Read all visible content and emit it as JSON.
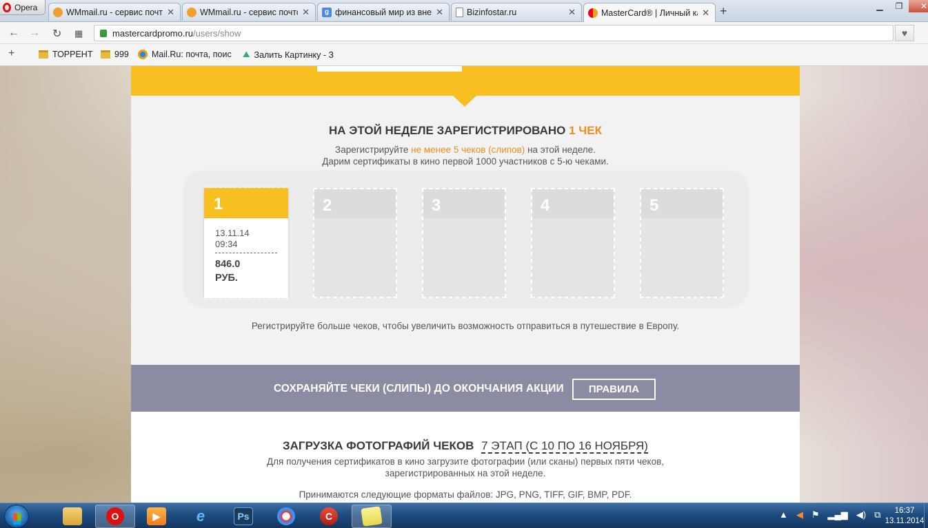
{
  "browser": {
    "app_name": "Opera",
    "tabs": [
      {
        "title": "WMmail.ru - сервис почто",
        "icon": "wmmail-icon",
        "color": "#f0a030"
      },
      {
        "title": "WMmail.ru - сервис почто",
        "icon": "wmmail-icon",
        "color": "#f0a030"
      },
      {
        "title": "финансовый мир из вне",
        "icon": "google-icon",
        "color": "#4a8be8"
      },
      {
        "title": "Bizinfostar.ru",
        "icon": "page-icon",
        "color": "#9aa"
      },
      {
        "title": "MasterCard® | Личный ка",
        "icon": "mastercard-icon",
        "color": "#eb001b"
      }
    ],
    "url_host": "mastercardpromo.ru",
    "url_path": "/users/show",
    "bookmarks": [
      {
        "label": "ТОРРЕНТ",
        "icon": "folder-icon"
      },
      {
        "label": "999",
        "icon": "folder-icon"
      },
      {
        "label": "Mail.Ru: почта, поис",
        "icon": "mailru-icon"
      },
      {
        "label": "Залить Картинку - З",
        "icon": "image-upload-icon"
      }
    ]
  },
  "page": {
    "week_title_prefix": "НА ЭТОЙ НЕДЕЛЕ ЗАРЕГИСТРИРОВАНО",
    "week_title_count": "1 ЧЕК",
    "week_sub_prefix": "Зарегистрируйте",
    "week_sub_highlight": "не менее 5 чеков (слипов)",
    "week_sub_suffix": "на этой неделе.",
    "week_sub_line2": "Дарим сертификаты в кино первой 1000 участников с 5-ю чеками.",
    "slips": [
      {
        "number": "1",
        "filled": true,
        "date": "13.11.14",
        "time": "09:34",
        "separator": "---------------",
        "amount": "846.0",
        "currency": "РУБ."
      },
      {
        "number": "2",
        "filled": false
      },
      {
        "number": "3",
        "filled": false
      },
      {
        "number": "4",
        "filled": false
      },
      {
        "number": "5",
        "filled": false
      }
    ],
    "more_text": "Регистрируйте больше чеков, чтобы увеличить возможность отправиться в путешествие в Европу.",
    "keep_text": "СОХРАНЯЙТЕ ЧЕКИ (СЛИПЫ) ДО ОКОНЧАНИЯ АКЦИИ",
    "rules_button": "ПРАВИЛА",
    "upload_title": "ЗАГРУЗКА ФОТОГРАФИЙ ЧЕКОВ",
    "upload_stage": "7 ЭТАП (С 10 ПО 16 НОЯБРЯ)",
    "upload_sub_line1": "Для получения сертификатов в кино загрузите фотографии (или сканы) первых пяти чеков,",
    "upload_sub_line2": "зарегистрированных на этой неделе.",
    "formats": "Принимаются следующие форматы файлов: JPG, PNG, TIFF, GIF, BMP, PDF.",
    "colors": {
      "accent_yellow": "#f7bf22",
      "accent_orange": "#f08c1f",
      "band_grey": "#8b8ba3"
    }
  },
  "taskbar": {
    "apps": [
      {
        "name": "explorer-icon",
        "label": ""
      },
      {
        "name": "opera-icon",
        "label": ""
      },
      {
        "name": "media-player-icon",
        "label": ""
      },
      {
        "name": "internet-explorer-icon",
        "label": ""
      },
      {
        "name": "photoshop-icon",
        "label": "Ps"
      },
      {
        "name": "paint-icon",
        "label": ""
      },
      {
        "name": "ccleaner-icon",
        "label": ""
      },
      {
        "name": "sticky-notes-icon",
        "label": ""
      }
    ],
    "time": "16:37",
    "date": "13.11.2014"
  }
}
